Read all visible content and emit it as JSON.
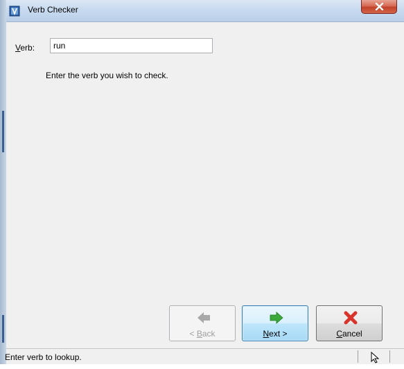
{
  "window": {
    "title": "Verb Checker",
    "close_label": "x"
  },
  "form": {
    "verb_label_accel": "V",
    "verb_label_rest": "erb:",
    "verb_value": "run",
    "instruction": "Enter the verb you wish to check."
  },
  "buttons": {
    "back": {
      "pre": "< ",
      "accel": "B",
      "post": "ack",
      "enabled": false,
      "icon": "arrow-left-icon"
    },
    "next": {
      "accel": "N",
      "post": "ext >",
      "enabled": true,
      "icon": "arrow-right-icon",
      "color": "#3aa83a"
    },
    "cancel": {
      "accel": "C",
      "post": "ancel",
      "enabled": true,
      "icon": "red-x-icon",
      "color": "#d9342b"
    }
  },
  "status": {
    "text": "Enter verb to lookup."
  }
}
